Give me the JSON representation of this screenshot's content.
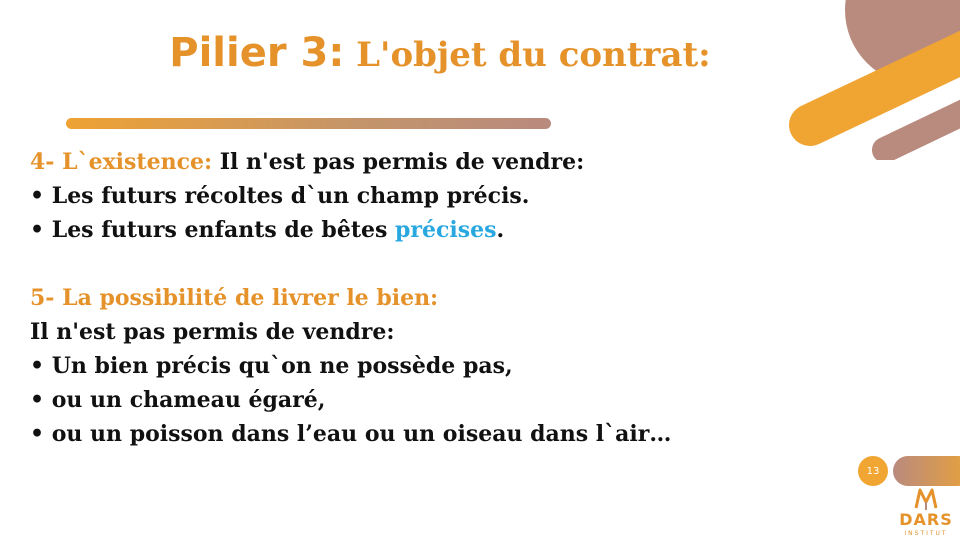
{
  "slide": {
    "title_part1": "Pilier 3:",
    "title_part2": " L'objet du contrat:",
    "page_number": "13",
    "section4": {
      "heading": "4- L`existence:",
      "heading_rest": " Il n'est pas permis de vendre:",
      "bullet1": "• Les futurs récoltes d`un champ précis.",
      "bullet2_start": "• Les futurs enfants de bêtes ",
      "bullet2_highlight": "précises",
      "bullet2_end": "."
    },
    "section5": {
      "heading": "5- La possibilité de livrer le bien:",
      "intro": "Il n'est pas permis de vendre:",
      "bullet1": "• Un bien précis qu`on ne possède pas,",
      "bullet2": "• ou un chameau égaré,",
      "bullet3": "• ou un poisson dans l’eau ou un oiseau dans l`air…"
    },
    "logo": {
      "name": "DARS",
      "tagline": "INSTITUT"
    }
  },
  "colors": {
    "accent_orange": "#E5922A",
    "highlight_blue": "#29A8E0",
    "decor_brown": "#B98A7E",
    "text_dark": "#111111"
  }
}
